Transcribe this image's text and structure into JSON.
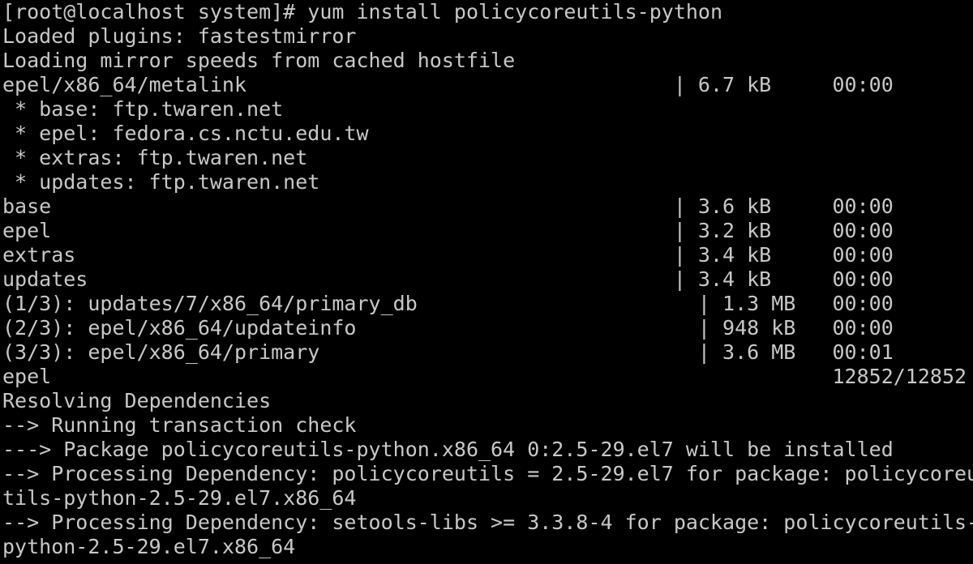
{
  "terminal": {
    "lines": [
      "[root@localhost system]# yum install policycoreutils-python",
      "Loaded plugins: fastestmirror",
      "Loading mirror speeds from cached hostfile",
      "epel/x86_64/metalink                                   | 6.7 kB     00:00",
      " * base: ftp.twaren.net",
      " * epel: fedora.cs.nctu.edu.tw",
      " * extras: ftp.twaren.net",
      " * updates: ftp.twaren.net",
      "base                                                   | 3.6 kB     00:00",
      "epel                                                   | 3.2 kB     00:00",
      "extras                                                 | 3.4 kB     00:00",
      "updates                                                | 3.4 kB     00:00",
      "(1/3): updates/7/x86_64/primary_db                       | 1.3 MB   00:00",
      "(2/3): epel/x86_64/updateinfo                            | 948 kB   00:00",
      "(3/3): epel/x86_64/primary                               | 3.6 MB   00:01",
      "epel                                                                12852/12852",
      "Resolving Dependencies",
      "--> Running transaction check",
      "---> Package policycoreutils-python.x86_64 0:2.5-29.el7 will be installed",
      "--> Processing Dependency: policycoreutils = 2.5-29.el7 for package: policycoreu",
      "tils-python-2.5-29.el7.x86_64",
      "--> Processing Dependency: setools-libs >= 3.3.8-4 for package: policycoreutils-",
      "python-2.5-29.el7.x86_64"
    ]
  }
}
